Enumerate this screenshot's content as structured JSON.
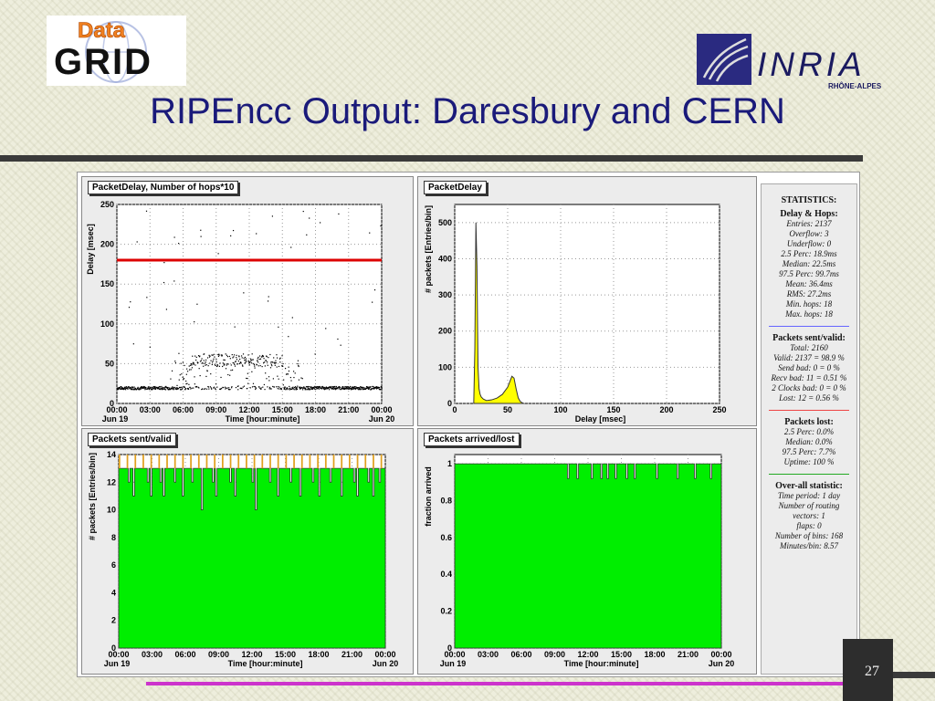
{
  "slide": {
    "title": "RIPEncc Output: Daresbury and CERN",
    "page_number": "27",
    "logo_left_top": "Data",
    "logo_left_bottom": "GRID",
    "logo_right_name": "INRIA",
    "logo_right_sub": "RHÔNE-ALPES"
  },
  "panels": {
    "delay_hops": {
      "title": "PacketDelay, Number of hops*10",
      "ylabel": "Delay [msec]",
      "xlabel": "Time [hour:minute]",
      "x_left": "Jun 19",
      "x_right": "Jun 20",
      "x_ticks": [
        "00:00",
        "03:00",
        "06:00",
        "09:00",
        "12:00",
        "15:00",
        "18:00",
        "21:00",
        "00:00"
      ],
      "y_ticks": [
        "0",
        "50",
        "100",
        "150",
        "200",
        "250"
      ]
    },
    "packet_delay": {
      "title": "PacketDelay",
      "ylabel": "# packets [Entries/bin]",
      "xlabel": "Delay [msec]",
      "x_ticks": [
        "0",
        "50",
        "100",
        "150",
        "200",
        "250"
      ],
      "y_ticks": [
        "0",
        "100",
        "200",
        "300",
        "400",
        "500"
      ]
    },
    "sent_valid": {
      "title": "Packets sent/valid",
      "ylabel": "# packets [Entries/bin]",
      "xlabel": "Time [hour:minute]",
      "x_left": "Jun 19",
      "x_right": "Jun 20",
      "x_ticks": [
        "00:00",
        "03:00",
        "06:00",
        "09:00",
        "12:00",
        "15:00",
        "18:00",
        "21:00",
        "00:00"
      ],
      "y_ticks": [
        "0",
        "2",
        "4",
        "6",
        "8",
        "10",
        "12",
        "14"
      ]
    },
    "arrived_lost": {
      "title": "Packets arrived/lost",
      "ylabel": "fraction arrived",
      "xlabel": "Time [hour:minute]",
      "x_left": "Jun 19",
      "x_right": "Jun 20",
      "x_ticks": [
        "00:00",
        "03:00",
        "06:00",
        "09:00",
        "12:00",
        "15:00",
        "18:00",
        "21:00",
        "00:00"
      ],
      "y_ticks": [
        "0",
        "0.2",
        "0.4",
        "0.6",
        "0.8",
        "1"
      ]
    }
  },
  "stats": {
    "header": "STATISTICS:",
    "delay_hops": {
      "head": "Delay & Hops:",
      "lines": [
        "Entries: 2137",
        "Overflow: 3",
        "Underflow: 0",
        "2.5 Perc:     18.9ms",
        "Median:     22.5ms",
        "97.5 Perc:     99.7ms",
        "Mean:     36.4ms",
        "RMS:     27.2ms",
        "Min. hops: 18",
        "Max. hops: 18"
      ]
    },
    "sent_valid": {
      "head": "Packets sent/valid:",
      "lines": [
        "Total: 2160",
        "Valid: 2137 = 98.9 %",
        "Send bad: 0 = 0 %",
        "Recv bad: 11 = 0.51 %",
        "2 Clocks bad: 0 = 0 %",
        "Lost: 12 = 0.56 %"
      ]
    },
    "lost": {
      "head": "Packets lost:",
      "lines": [
        "2.5 Perc:     0.0%",
        "Median:     0.0%",
        "97.5 Perc:     7.7%",
        "Uptime: 100 %"
      ]
    },
    "overall": {
      "head": "Over-all statistic:",
      "lines": [
        "Time period: 1 day",
        "Number of routing",
        "vectors: 1",
        "flaps: 0",
        "Number of bins: 168",
        "Minutes/bin: 8.57"
      ]
    }
  },
  "chart_data": [
    {
      "type": "scatter",
      "title": "PacketDelay, Number of hops*10",
      "xlabel": "Time [hour:minute]",
      "ylabel": "Delay [msec]",
      "xlim": [
        0,
        24
      ],
      "ylim": [
        0,
        250
      ],
      "baseline_ms": 20,
      "midday_level_ms": 55,
      "hops_line": 180,
      "hops_line_color": "#dd0000",
      "grid": true
    },
    {
      "type": "bar",
      "title": "PacketDelay",
      "xlabel": "Delay [msec]",
      "ylabel": "# packets [Entries/bin]",
      "xlim": [
        0,
        250
      ],
      "ylim": [
        0,
        550
      ],
      "x": [
        18,
        19,
        20,
        21,
        22,
        23,
        24,
        25,
        27,
        30,
        35,
        40,
        45,
        50,
        52,
        54,
        56,
        58,
        60,
        62,
        65
      ],
      "values": [
        5,
        150,
        500,
        380,
        100,
        40,
        25,
        18,
        12,
        8,
        10,
        15,
        25,
        45,
        60,
        75,
        70,
        40,
        15,
        5,
        0
      ],
      "fill_color": "#ffff00",
      "grid": true
    },
    {
      "type": "bar",
      "title": "Packets sent/valid",
      "xlabel": "Time [hour:minute]",
      "ylabel": "# packets [Entries/bin]",
      "xlim": [
        0,
        24
      ],
      "ylim": [
        0,
        14
      ],
      "bins": 168,
      "typical_value": 13,
      "dips": [
        [
          6,
          12
        ],
        [
          9,
          11
        ],
        [
          18,
          12
        ],
        [
          20,
          11
        ],
        [
          26,
          12
        ],
        [
          28,
          11
        ],
        [
          35,
          12
        ],
        [
          40,
          11
        ],
        [
          46,
          12
        ],
        [
          52,
          10
        ],
        [
          59,
          12
        ],
        [
          61,
          11
        ],
        [
          70,
          12
        ],
        [
          73,
          11
        ],
        [
          84,
          12
        ],
        [
          86,
          10
        ],
        [
          95,
          12
        ],
        [
          100,
          11
        ],
        [
          108,
          12
        ],
        [
          114,
          11
        ],
        [
          122,
          12
        ],
        [
          126,
          11
        ],
        [
          133,
          12
        ],
        [
          140,
          11
        ],
        [
          148,
          12
        ],
        [
          150,
          11
        ],
        [
          157,
          12
        ],
        [
          160,
          11
        ],
        [
          164,
          12
        ]
      ],
      "fill_color": "#00ee00",
      "grid": true
    },
    {
      "type": "bar",
      "title": "Packets arrived/lost",
      "xlabel": "Time [hour:minute]",
      "ylabel": "fraction arrived",
      "xlim": [
        0,
        24
      ],
      "ylim": [
        0,
        1.05
      ],
      "bins": 168,
      "typical_value": 1.0,
      "dips": [
        [
          71,
          0.92
        ],
        [
          77,
          0.92
        ],
        [
          86,
          0.92
        ],
        [
          92,
          0.92
        ],
        [
          96,
          0.92
        ],
        [
          101,
          0.92
        ],
        [
          108,
          0.92
        ],
        [
          113,
          0.92
        ],
        [
          127,
          0.92
        ],
        [
          140,
          0.92
        ],
        [
          151,
          0.92
        ],
        [
          161,
          0.92
        ]
      ],
      "fill_color": "#00ee00",
      "grid": true
    }
  ]
}
